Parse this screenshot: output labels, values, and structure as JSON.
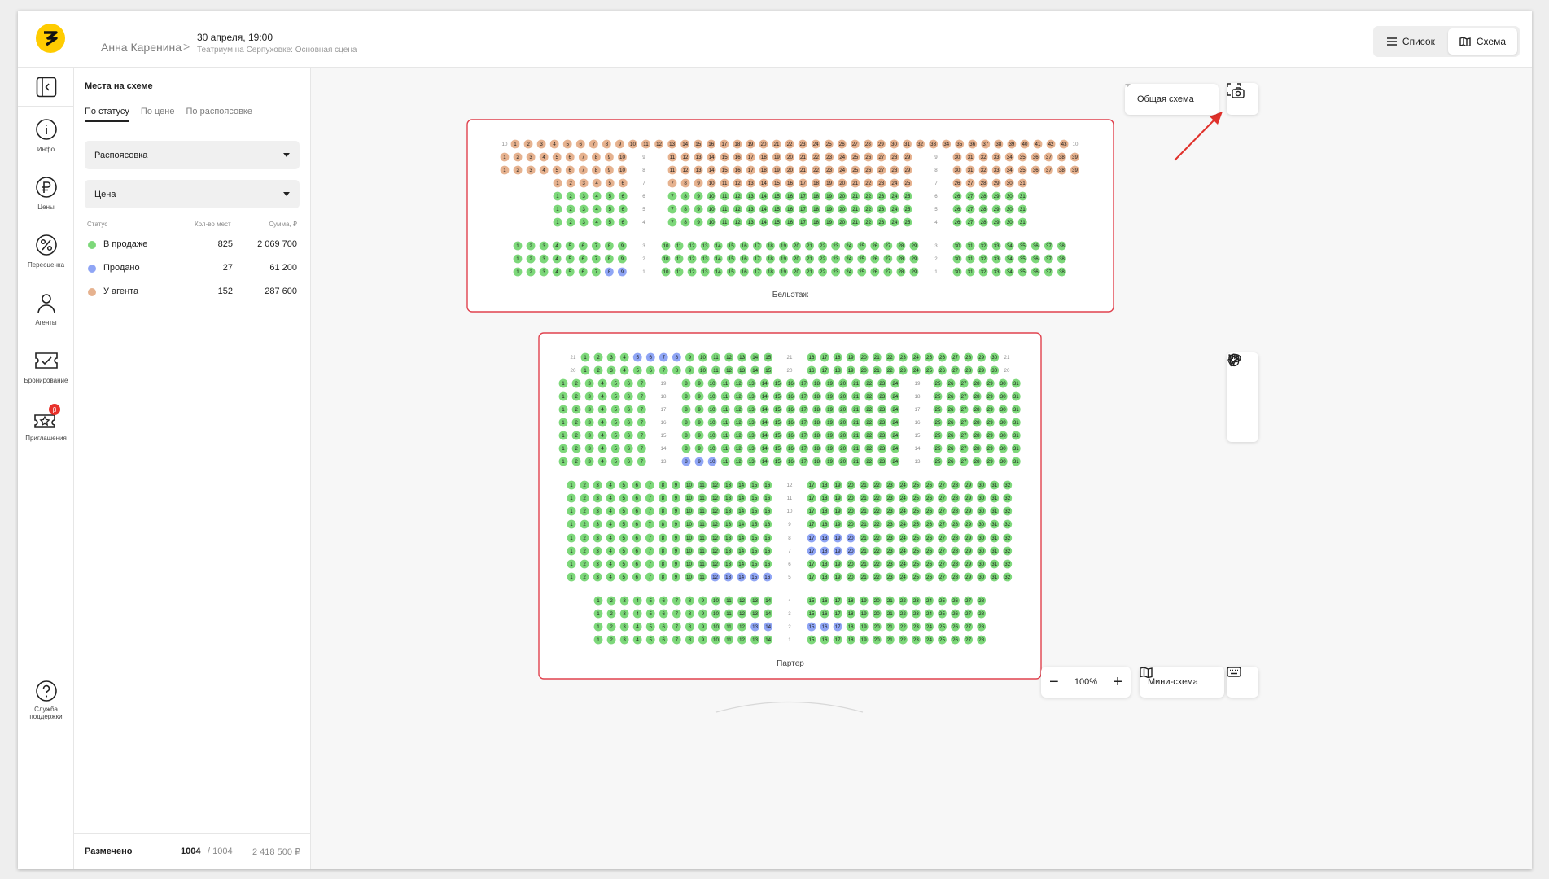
{
  "header": {
    "user_name": "Анна Каренина",
    "breadcrumb_separator": ">",
    "event_date": "30 апреля, 19:00",
    "venue": "Театриум на Серпуховке: Основная сцена",
    "view_list_label": "Список",
    "view_scheme_label": "Схема"
  },
  "nav": {
    "items": [
      {
        "label": "Инфо",
        "icon": "info-icon"
      },
      {
        "label": "Цены",
        "icon": "ruble-icon"
      },
      {
        "label": "Переоценка",
        "icon": "percent-icon"
      },
      {
        "label": "Агенты",
        "icon": "person-icon"
      },
      {
        "label": "Бронирование",
        "icon": "ticket-check-icon"
      },
      {
        "label": "Приглашения",
        "icon": "invitation-icon",
        "badge": "β"
      }
    ],
    "support_label_1": "Служба",
    "support_label_2": "поддержки"
  },
  "panel": {
    "title": "Места на схеме",
    "tabs": [
      "По статусу",
      "По цене",
      "По распоясовке"
    ],
    "active_tab": "По статусу",
    "dropdown_1": "Распоясовка",
    "dropdown_2": "Цена",
    "col_status": "Статус",
    "col_count": "Кол-во мест",
    "col_sum": "Сумма, ₽",
    "rows": [
      {
        "name": "В продаже",
        "count": "825",
        "sum": "2 069 700",
        "color": "#7dd87a"
      },
      {
        "name": "Продано",
        "count": "27",
        "sum": "61 200",
        "color": "#8fa5f5"
      },
      {
        "name": "У агента",
        "count": "152",
        "sum": "287 600",
        "color": "#e6b28f"
      }
    ],
    "footer_label": "Размечено",
    "footer_marked": "1004",
    "footer_total": "/ 1004",
    "footer_sum": "2 418 500 ₽"
  },
  "canvas": {
    "scheme_select": "Общая схема",
    "zoom_value": "100%",
    "minimap_label": "Мини-схема",
    "section_beletage": "Бельэтаж",
    "section_parterre": "Партер"
  },
  "colors": {
    "available": "#7dd87a",
    "sold": "#8fa5f5",
    "agent": "#e6b28f",
    "section_border": "#e0424e",
    "annotation_arrow": "#e0312b"
  }
}
